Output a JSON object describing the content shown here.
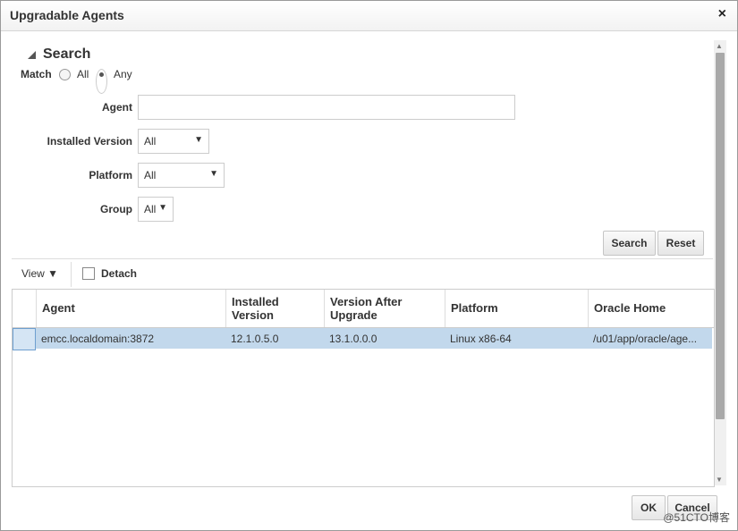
{
  "dialog": {
    "title": "Upgradable Agents",
    "close": "×"
  },
  "search": {
    "header": "Search",
    "match_label": "Match",
    "match_options": [
      "All",
      "Any"
    ],
    "match_selected": "Any",
    "fields": {
      "agent_label": "Agent",
      "agent_value": "",
      "installed_version_label": "Installed Version",
      "installed_version_value": "All",
      "platform_label": "Platform",
      "platform_value": "All",
      "group_label": "Group",
      "group_value": "All"
    },
    "search_button": "Search",
    "reset_button": "Reset"
  },
  "toolbar": {
    "view_label": "View ▼",
    "detach_label": "Detach"
  },
  "table": {
    "columns": [
      "Agent",
      "Installed Version",
      "Version After Upgrade",
      "Platform",
      "Oracle Home"
    ],
    "rows": [
      [
        "emcc.localdomain:3872",
        "12.1.0.5.0",
        "13.1.0.0.0",
        "Linux x86-64",
        "/u01/app/oracle/age..."
      ]
    ]
  },
  "footer": {
    "ok_label": "OK",
    "cancel_label": "Cancel"
  },
  "watermark": "@51CTO博客"
}
